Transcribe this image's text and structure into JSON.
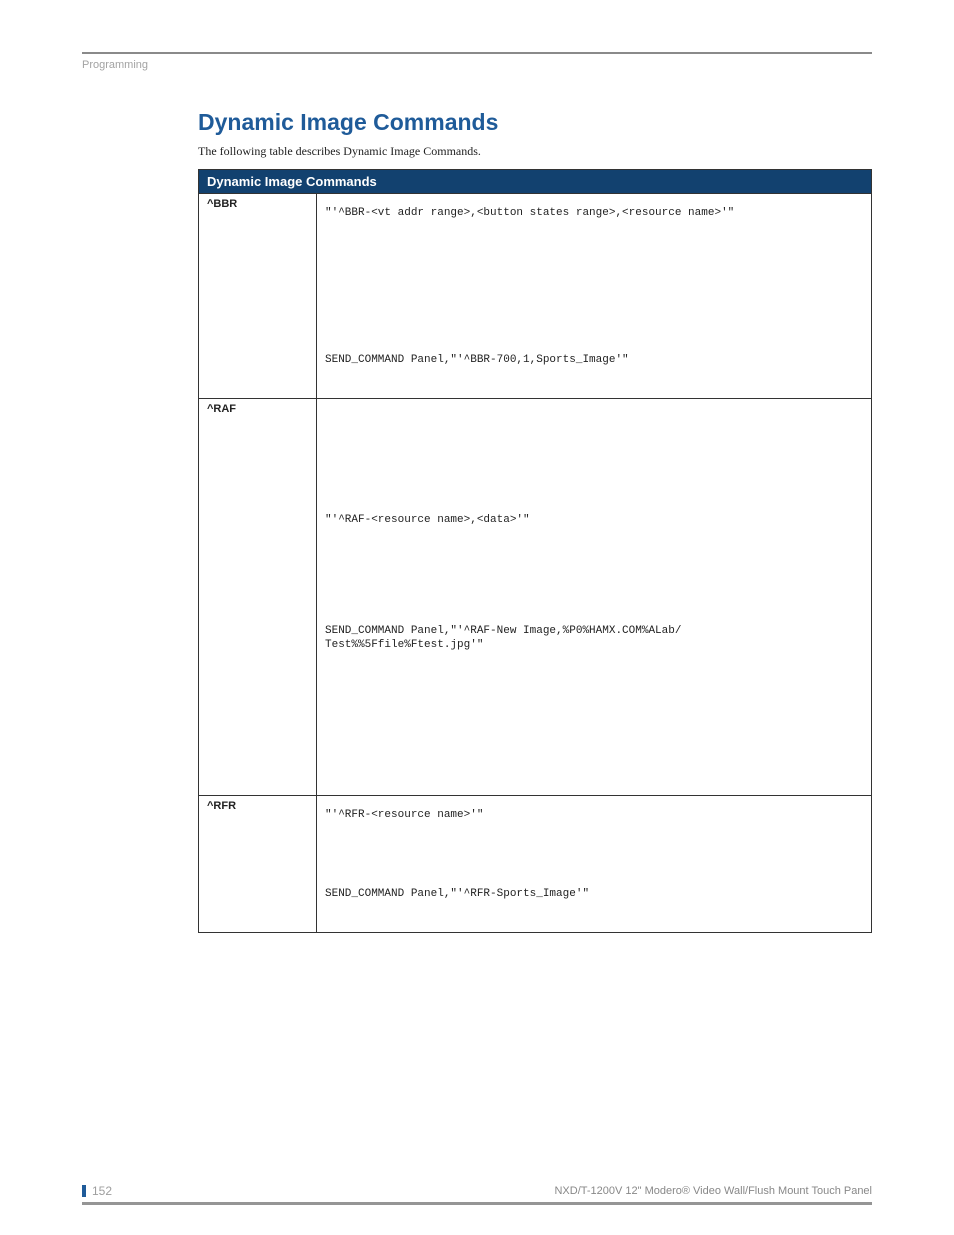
{
  "header": {
    "section": "Programming"
  },
  "main": {
    "heading": "Dynamic Image Commands",
    "intro": "The following table describes Dynamic Image Commands.",
    "table_title": "Dynamic Image Commands",
    "rows": [
      {
        "cmd": "^BBR",
        "syntax": "\"'^BBR-<vt addr range>,<button states range>,<resource name>'\"",
        "example": "SEND_COMMAND Panel,\"'^BBR-700,1,Sports_Image'\""
      },
      {
        "cmd": "^RAF",
        "syntax": "\"'^RAF-<resource name>,<data>'\"",
        "example_l1": "SEND_COMMAND Panel,\"'^RAF-New Image,%P0%HAMX.COM%ALab/",
        "example_l2": "Test%%5Ffile%Ftest.jpg'\""
      },
      {
        "cmd": "^RFR",
        "syntax": "\"'^RFR-<resource name>'\"",
        "example": "SEND_COMMAND Panel,\"'^RFR-Sports_Image'\""
      }
    ]
  },
  "footer": {
    "page_num": "152",
    "doc_title": "NXD/T-1200V 12\" Modero® Video Wall/Flush Mount Touch Panel"
  }
}
